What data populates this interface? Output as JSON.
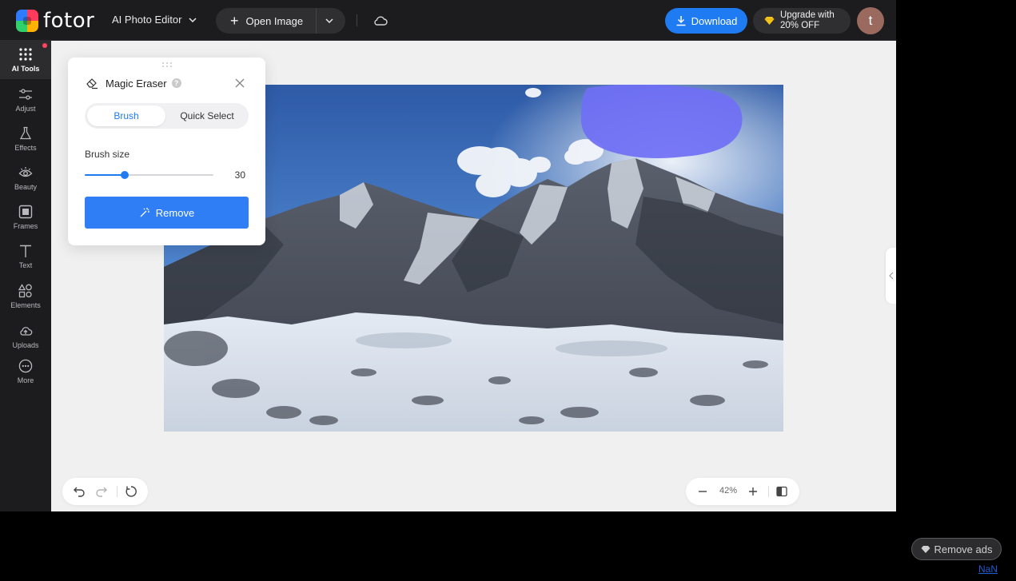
{
  "header": {
    "logo_text": "fotor",
    "editor_menu_label": "AI Photo Editor",
    "open_image_label": "Open Image",
    "download_label": "Download",
    "upgrade_line1": "Upgrade with",
    "upgrade_line2": "20% OFF",
    "avatar_initial": "t"
  },
  "sidebar": {
    "items": [
      {
        "label": "AI Tools",
        "icon": "grid-dots-icon",
        "active": true
      },
      {
        "label": "Adjust",
        "icon": "sliders-icon"
      },
      {
        "label": "Effects",
        "icon": "flask-icon"
      },
      {
        "label": "Beauty",
        "icon": "eye-icon"
      },
      {
        "label": "Frames",
        "icon": "frame-icon"
      },
      {
        "label": "Text",
        "icon": "text-icon"
      },
      {
        "label": "Elements",
        "icon": "shapes-icon"
      },
      {
        "label": "Uploads",
        "icon": "upload-cloud-icon"
      },
      {
        "label": "More",
        "icon": "more-dots-icon"
      }
    ]
  },
  "panel": {
    "title": "Magic Eraser",
    "help": "?",
    "tabs": {
      "brush": "Brush",
      "quick_select": "Quick Select"
    },
    "brush_size_label": "Brush size",
    "brush_size_value": "30",
    "brush_size_fraction": 0.31,
    "remove_label": "Remove"
  },
  "zoom": {
    "value": "42%"
  },
  "ads": {
    "remove_ads_label": "Remove ads",
    "link_text": "NaN"
  },
  "colors": {
    "accent": "#1e7bf2",
    "topbar": "#1c1c1e",
    "canvas": "#f0f0f0",
    "brush_mark": "#6f6ff5"
  }
}
